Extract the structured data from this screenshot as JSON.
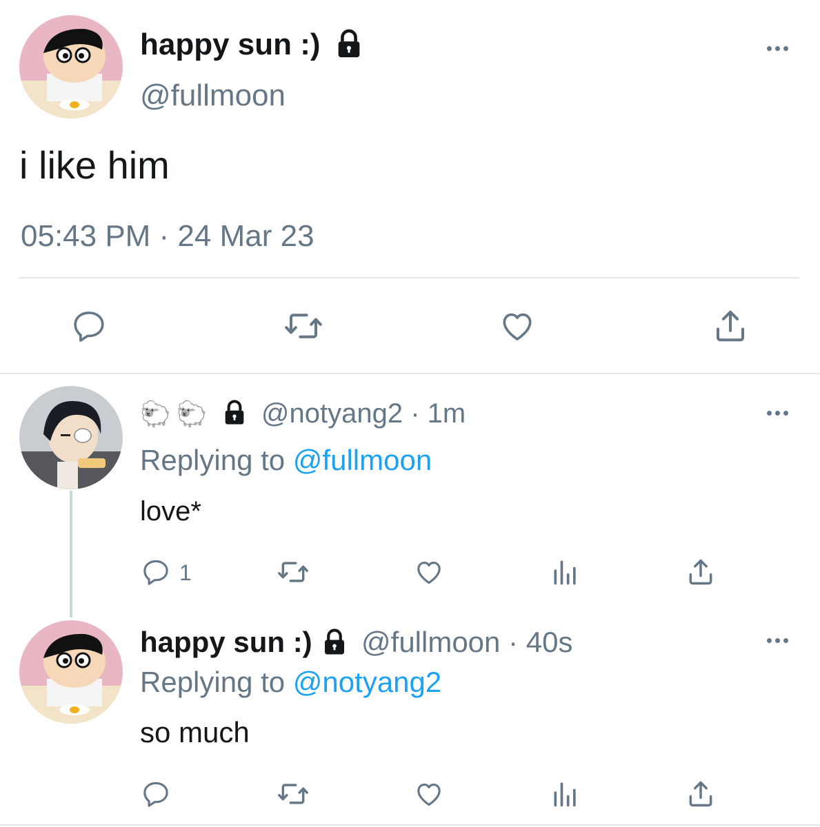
{
  "main_tweet": {
    "display_name": "happy sun :)",
    "handle": "@fullmoon",
    "text": "i like him",
    "timestamp": "05:43 PM · 24 Mar 23"
  },
  "reply1": {
    "display_name": "🐑🐑",
    "handle": "@notyang2",
    "time": "· 1m",
    "replying_prefix": "Replying to",
    "replying_handle": "@fullmoon",
    "text": "love*",
    "reply_count": "1"
  },
  "reply2": {
    "display_name": "happy sun :)",
    "handle": "@fullmoon",
    "time": "· 40s",
    "replying_prefix": "Replying to",
    "replying_handle": "@notyang2",
    "text": "so much"
  },
  "colors": {
    "accent": "#1da1f2",
    "muted": "#657786",
    "divider": "#e1e8ed",
    "text": "#14171a"
  },
  "icons": [
    "lock-icon",
    "more-icon",
    "reply-icon",
    "retweet-icon",
    "like-icon",
    "share-icon",
    "analytics-icon"
  ]
}
